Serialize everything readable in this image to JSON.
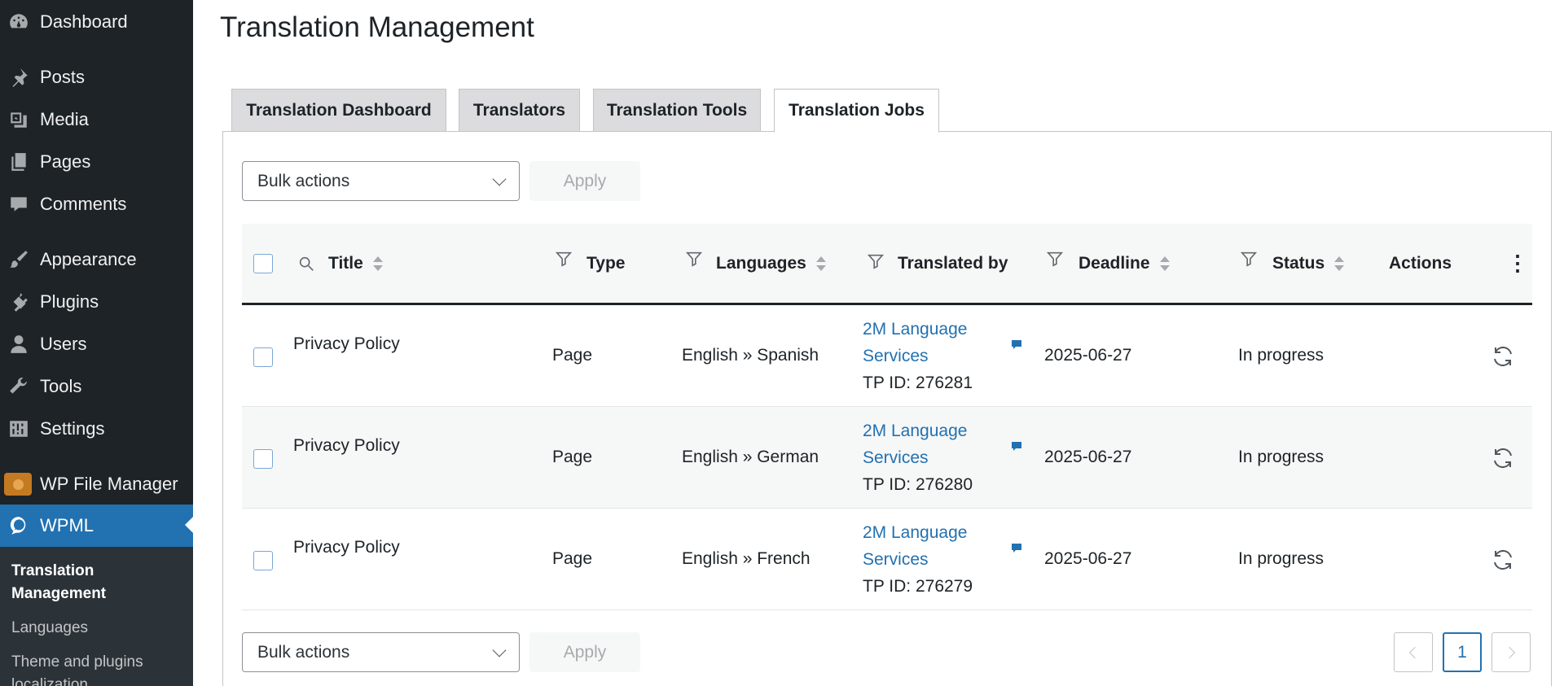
{
  "sidebar": {
    "items": [
      {
        "label": "Dashboard",
        "icon": "dashboard-icon"
      },
      {
        "label": "Posts",
        "icon": "pin-icon"
      },
      {
        "label": "Media",
        "icon": "media-icon"
      },
      {
        "label": "Pages",
        "icon": "pages-icon"
      },
      {
        "label": "Comments",
        "icon": "comment-icon"
      },
      {
        "label": "Appearance",
        "icon": "brush-icon"
      },
      {
        "label": "Plugins",
        "icon": "plugin-icon"
      },
      {
        "label": "Users",
        "icon": "user-icon"
      },
      {
        "label": "Tools",
        "icon": "wrench-icon"
      },
      {
        "label": "Settings",
        "icon": "settings-icon"
      },
      {
        "label": "WP File Manager",
        "icon": "file-manager-icon"
      },
      {
        "label": "WPML",
        "icon": "wpml-icon"
      }
    ],
    "submenu": [
      {
        "label": "Translation Management"
      },
      {
        "label": "Languages"
      },
      {
        "label": "Theme and plugins localization"
      }
    ]
  },
  "page": {
    "title": "Translation Management"
  },
  "tabs": [
    {
      "label": "Translation Dashboard"
    },
    {
      "label": "Translators"
    },
    {
      "label": "Translation Tools"
    },
    {
      "label": "Translation Jobs"
    }
  ],
  "bulk": {
    "label": "Bulk actions",
    "apply": "Apply"
  },
  "table": {
    "columns": {
      "title": "Title",
      "type": "Type",
      "languages": "Languages",
      "translated_by": "Translated by",
      "deadline": "Deadline",
      "status": "Status",
      "actions": "Actions"
    },
    "rows": [
      {
        "title": "Privacy Policy",
        "type": "Page",
        "languages": "English » Spanish",
        "translator_line1": "2M Language",
        "translator_line2": "Services",
        "tp_id": "TP ID: 276281",
        "deadline": "2025-06-27",
        "status": "In progress"
      },
      {
        "title": "Privacy Policy",
        "type": "Page",
        "languages": "English » German",
        "translator_line1": "2M Language",
        "translator_line2": "Services",
        "tp_id": "TP ID: 276280",
        "deadline": "2025-06-27",
        "status": "In progress"
      },
      {
        "title": "Privacy Policy",
        "type": "Page",
        "languages": "English » French",
        "translator_line1": "2M Language",
        "translator_line2": "Services",
        "tp_id": "TP ID: 276279",
        "deadline": "2025-06-27",
        "status": "In progress"
      }
    ]
  },
  "pagination": {
    "current": "1"
  }
}
